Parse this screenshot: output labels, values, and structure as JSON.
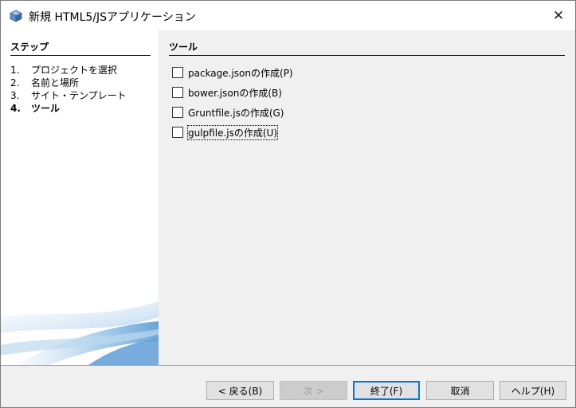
{
  "window": {
    "title": "新規 HTML5/JSアプリケーション",
    "close_glyph": "✕"
  },
  "steps": {
    "title": "ステップ",
    "items": [
      {
        "num": "1.",
        "label": "プロジェクトを選択"
      },
      {
        "num": "2.",
        "label": "名前と場所"
      },
      {
        "num": "3.",
        "label": "サイト・テンプレート"
      },
      {
        "num": "4.",
        "label": "ツール"
      }
    ]
  },
  "panel": {
    "title": "ツール",
    "options": [
      {
        "label": "package.jsonの作成(P)",
        "checked": false
      },
      {
        "label": "bower.jsonの作成(B)",
        "checked": false
      },
      {
        "label": "Gruntfile.jsの作成(G)",
        "checked": false
      },
      {
        "label": "gulpfile.jsの作成(U)",
        "checked": false
      }
    ]
  },
  "buttons": {
    "back": "< 戻る(B)",
    "next": "次 >",
    "finish": "終了(F)",
    "cancel": "取消",
    "help": "ヘルプ(H)"
  },
  "colors": {
    "accent": "#0078d7",
    "icon_blue": "#3c7fc1"
  }
}
